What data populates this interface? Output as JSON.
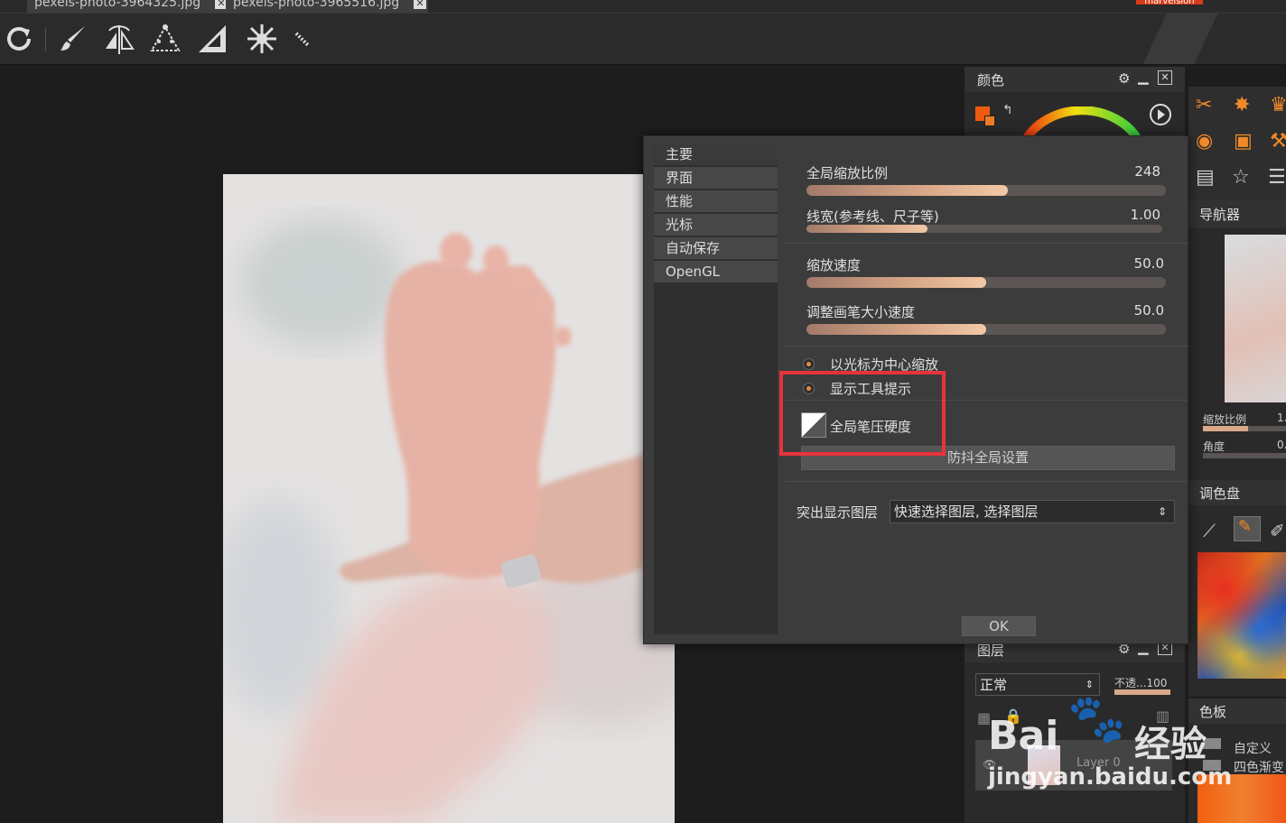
{
  "tabs": [
    {
      "label": "pexels-photo-3964325.jpg",
      "close": "✕"
    },
    {
      "label": "pexels-photo-3965516.jpg",
      "close": "✕"
    }
  ],
  "version_badge": "marvelsion",
  "toolbar": {
    "icons": [
      "redo-icon",
      "brush-icon",
      "mirror-icon",
      "perspective-icon",
      "ruler-icon",
      "kaleidoscope-icon",
      "stroke-icon"
    ]
  },
  "color_panel": {
    "title": "颜色"
  },
  "navigator_panel": {
    "title": "导航器",
    "zoom_label": "缩放比例",
    "zoom_value": "1.",
    "angle_label": "角度",
    "angle_value": "0."
  },
  "palette_panel": {
    "title": "调色盘"
  },
  "swatches_panel": {
    "title": "色板",
    "items": [
      "自定义",
      "四色渐变"
    ]
  },
  "layers_panel": {
    "title": "图层",
    "blend_mode": "正常",
    "opacity_label": "不透...100",
    "layer_name": "Layer 0"
  },
  "dialog": {
    "nav": [
      "主要",
      "界面",
      "性能",
      "光标",
      "自动保存",
      "OpenGL"
    ],
    "sliders": [
      {
        "label": "全局缩放比例",
        "value": "248",
        "fraction": 0.56
      },
      {
        "label": "线宽(参考线、尺子等)",
        "value": "1.00",
        "fraction": 0.34
      },
      {
        "label": "缩放速度",
        "value": "50.0",
        "fraction": 0.5
      },
      {
        "label": "调整画笔大小速度",
        "value": "50.0",
        "fraction": 0.5
      }
    ],
    "radios": [
      "以光标为中心缩放",
      "显示工具提示"
    ],
    "pressure_label": "全局笔压硬度",
    "antishake_button": "防抖全局设置",
    "highlight_label": "突出显示图层",
    "highlight_value": "快速选择图层, 选择图层",
    "ok_button": "OK"
  },
  "watermark": {
    "line1": "Bai",
    "line1b": "经验",
    "line2": "jingyan.baidu.com"
  },
  "colors": {
    "accent": "#f07c28",
    "highlight_box": "#e8333c"
  }
}
